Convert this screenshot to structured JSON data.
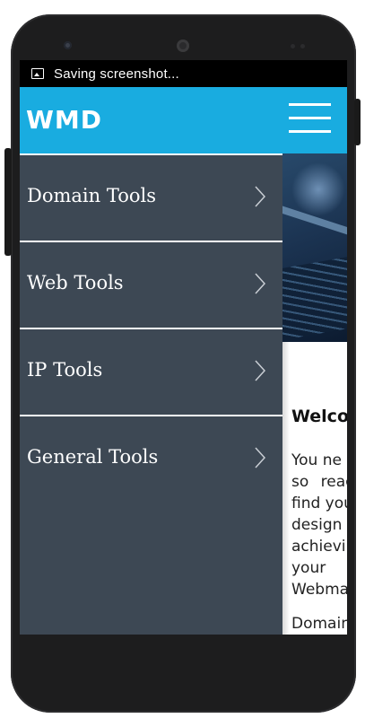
{
  "status_bar": {
    "icon": "image-icon",
    "notification": "Saving screenshot..."
  },
  "header": {
    "logo": "WMD",
    "background": "#19ace0",
    "menu_icon": "hamburger-menu-icon"
  },
  "drawer": {
    "background": "#3d4854",
    "items": [
      {
        "label": "Domain Tools"
      },
      {
        "label": "Web Tools"
      },
      {
        "label": "IP Tools"
      },
      {
        "label": "General Tools"
      }
    ],
    "chevron_icon": "chevron-right-icon"
  },
  "main": {
    "welcome_heading": "Welco",
    "paragraph_lines": [
      "You ne",
      "so reac",
      "find you",
      "design",
      "achievi",
      "your",
      "Webma"
    ],
    "second_paragraph": "Domain"
  }
}
